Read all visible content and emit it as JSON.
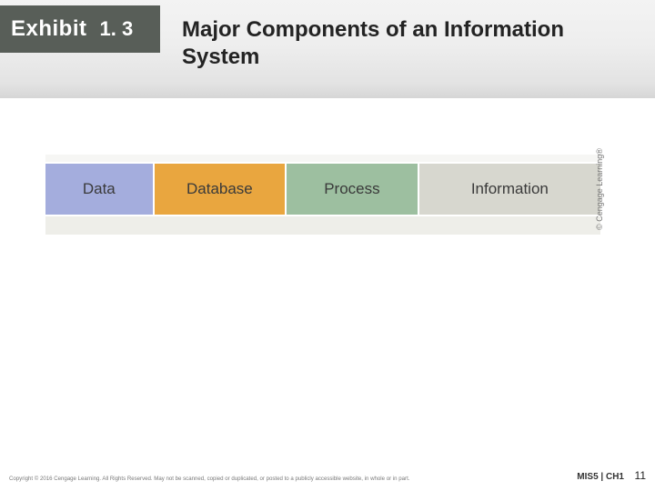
{
  "exhibit": {
    "label": "Exhibit",
    "number": "1. 3"
  },
  "title": "Major Components of an Information System",
  "chart_data": {
    "type": "table",
    "categories": [
      "Data",
      "Database",
      "Process",
      "Information"
    ],
    "title": "Major Components of an Information System"
  },
  "credit_side": "© Cengage Learning®",
  "footer_left": "Copyright © 2016 Cengage Learning. All Rights Reserved. May not be scanned, copied or duplicated, or posted to a publicly accessible website, in whole or in part.",
  "footer_right": "MIS5 | CH1",
  "page_number": "11"
}
